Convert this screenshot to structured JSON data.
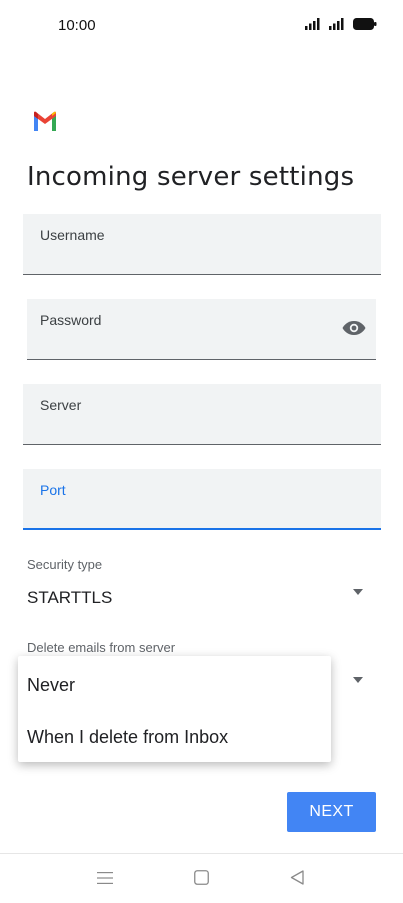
{
  "status_bar": {
    "time": "10:00"
  },
  "header": {
    "title": "Incoming server settings",
    "logo_icon": "gmail-logo"
  },
  "form": {
    "fields": [
      {
        "label": "Username",
        "value": ""
      },
      {
        "label": "Password",
        "value": ""
      },
      {
        "label": "Server",
        "value": ""
      },
      {
        "label": "Port",
        "value": ""
      }
    ],
    "security_type": {
      "label": "Security type",
      "value": "STARTTLS"
    },
    "delete_emails": {
      "label": "Delete emails from server"
    }
  },
  "dropdown_menu": {
    "options": [
      "Never",
      "When I delete from Inbox"
    ]
  },
  "actions": {
    "next_label": "NEXT"
  },
  "colors": {
    "accent": "#1a73e8",
    "button": "#4285f4",
    "field_bg": "#f1f3f4"
  }
}
